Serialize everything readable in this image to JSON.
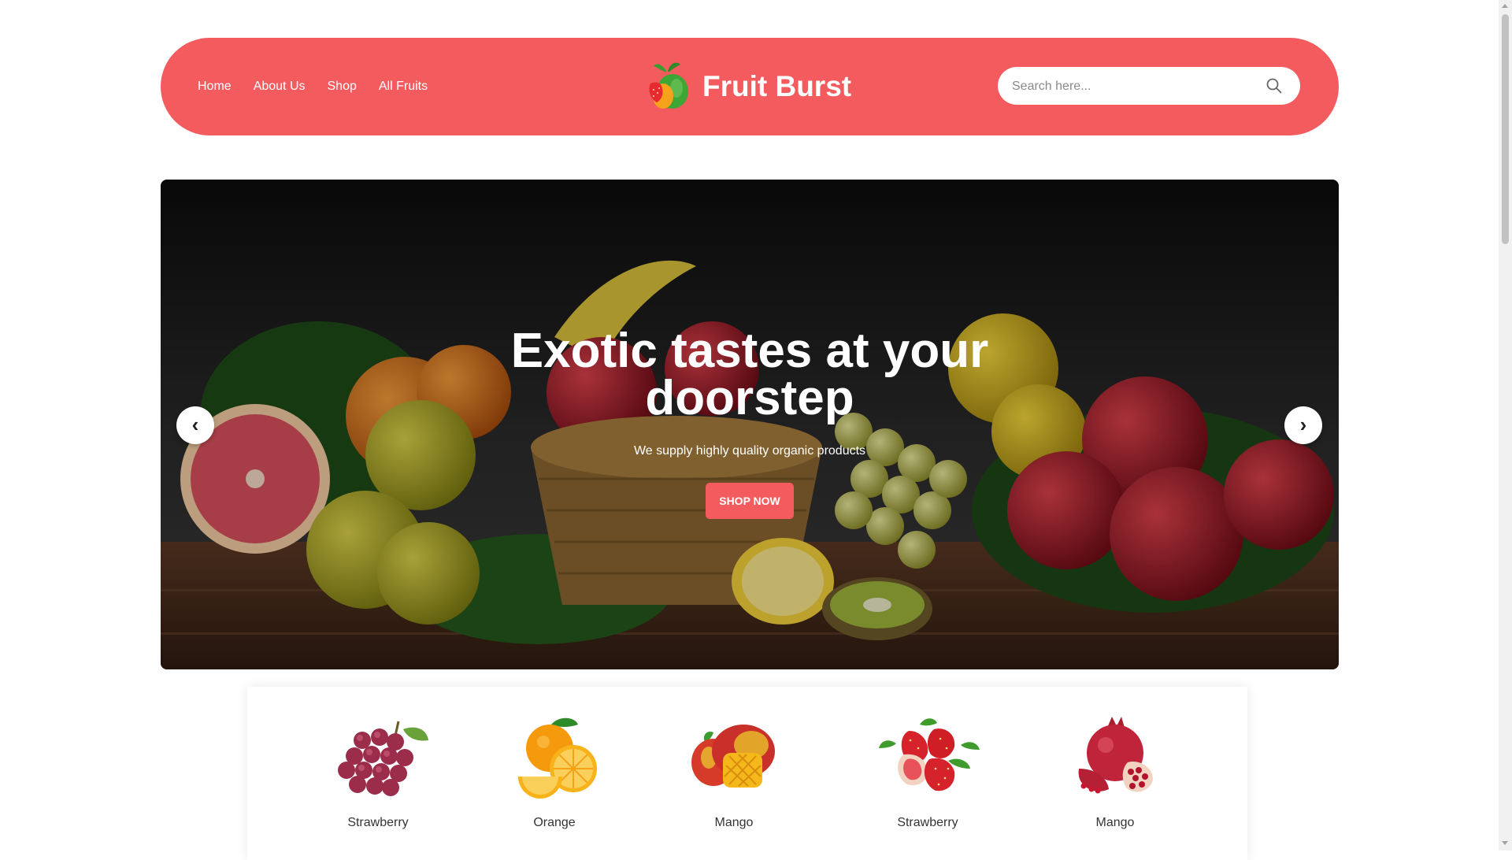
{
  "nav": {
    "items": [
      {
        "label": "Home"
      },
      {
        "label": "About Us"
      },
      {
        "label": "Shop"
      },
      {
        "label": "All Fruits"
      }
    ]
  },
  "brand": {
    "name": "Fruit Burst",
    "logo_icon": "fruit-logo-icon"
  },
  "search": {
    "placeholder": "Search here...",
    "value": "",
    "icon": "search-icon"
  },
  "hero": {
    "title_line1": "Exotic tastes at your",
    "title_line2": "doorstep",
    "subtitle": "We supply highly quality organic products",
    "cta_label": "SHOP NOW",
    "prev_label": "‹",
    "next_label": "›"
  },
  "categories": [
    {
      "label": "Strawberry",
      "icon": "grapes-icon"
    },
    {
      "label": "Orange",
      "icon": "orange-icon"
    },
    {
      "label": "Mango",
      "icon": "mango-icon"
    },
    {
      "label": "Strawberry",
      "icon": "strawberry-icon"
    },
    {
      "label": "Mango",
      "icon": "pomegranate-icon"
    }
  ],
  "colors": {
    "accent": "#f45b5f",
    "text": "#333333",
    "white": "#ffffff"
  }
}
